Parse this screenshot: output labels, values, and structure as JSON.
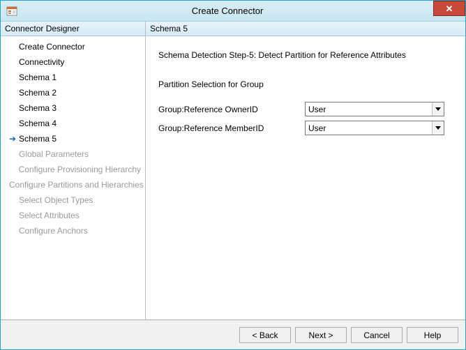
{
  "window": {
    "title": "Create Connector"
  },
  "sidebar": {
    "header": "Connector Designer",
    "items": [
      {
        "label": "Create Connector",
        "active": false,
        "disabled": false
      },
      {
        "label": "Connectivity",
        "active": false,
        "disabled": false
      },
      {
        "label": "Schema 1",
        "active": false,
        "disabled": false
      },
      {
        "label": "Schema 2",
        "active": false,
        "disabled": false
      },
      {
        "label": "Schema 3",
        "active": false,
        "disabled": false
      },
      {
        "label": "Schema 4",
        "active": false,
        "disabled": false
      },
      {
        "label": "Schema 5",
        "active": true,
        "disabled": false
      },
      {
        "label": "Global Parameters",
        "active": false,
        "disabled": true
      },
      {
        "label": "Configure Provisioning Hierarchy",
        "active": false,
        "disabled": true
      },
      {
        "label": "Configure Partitions and Hierarchies",
        "active": false,
        "disabled": true
      },
      {
        "label": "Select Object Types",
        "active": false,
        "disabled": true
      },
      {
        "label": "Select Attributes",
        "active": false,
        "disabled": true
      },
      {
        "label": "Configure Anchors",
        "active": false,
        "disabled": true
      }
    ]
  },
  "main": {
    "header": "Schema 5",
    "step_description": "Schema Detection Step-5: Detect Partition for Reference Attributes",
    "section_title": "Partition Selection for Group",
    "fields": [
      {
        "label": "Group:Reference OwnerID",
        "value": "User"
      },
      {
        "label": "Group:Reference MemberID",
        "value": "User"
      }
    ]
  },
  "buttons": {
    "back": "<  Back",
    "next": "Next  >",
    "cancel": "Cancel",
    "help": "Help"
  }
}
